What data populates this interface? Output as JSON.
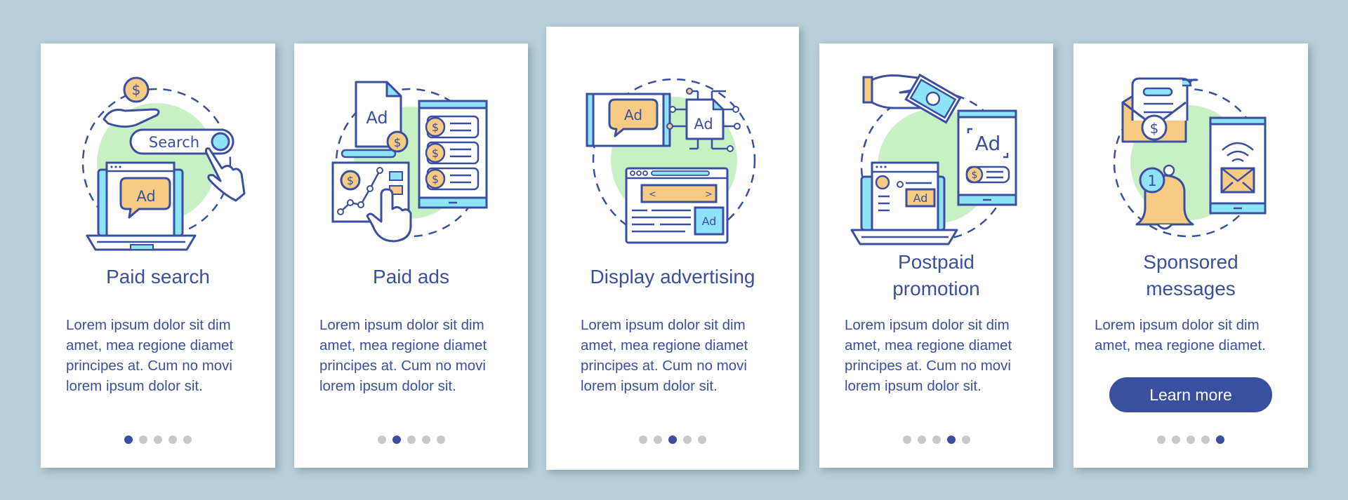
{
  "colors": {
    "background": "#b8ced8",
    "card": "#ffffff",
    "primary": "#3a4fa0",
    "dot_inactive": "#c8c8c8",
    "accent_green": "#c9f0c4",
    "accent_orange": "#f8cb85",
    "accent_cyan": "#8fe3f7"
  },
  "cards": [
    {
      "title": "Paid search",
      "illustration": "paid-search-illustration",
      "search_label": "Search",
      "ad_label": "Ad",
      "body": "Lorem ipsum dolor sit dim\namet, mea regione diamet\nprincipes at. Cum no movi\nlorem ipsum dolor sit.",
      "page_index": 1,
      "page_count": 5
    },
    {
      "title": "Paid ads",
      "illustration": "paid-ads-illustration",
      "ad_label": "Ad",
      "body": "Lorem ipsum dolor sit dim\namet, mea regione diamet\nprincipes at. Cum no movi\nlorem ipsum dolor sit.",
      "page_index": 2,
      "page_count": 5
    },
    {
      "title": "Display advertising",
      "illustration": "display-advertising-illustration",
      "ad_label": "Ad",
      "body": "Lorem ipsum dolor sit dim\namet, mea regione diamet\nprincipes at. Cum no movi\nlorem ipsum dolor sit.",
      "page_index": 3,
      "page_count": 5
    },
    {
      "title": "Postpaid\npromotion",
      "illustration": "postpaid-promotion-illustration",
      "ad_label": "Ad",
      "body": "Lorem ipsum dolor sit dim\namet, mea regione diamet\nprincipes at. Cum no movi\nlorem ipsum dolor sit.",
      "page_index": 4,
      "page_count": 5
    },
    {
      "title": "Sponsored\nmessages",
      "illustration": "sponsored-messages-illustration",
      "notification_count": "1",
      "body": "Lorem ipsum dolor sit dim\namet, mea regione diamet.",
      "button_label": "Learn more",
      "page_index": 5,
      "page_count": 5
    }
  ]
}
